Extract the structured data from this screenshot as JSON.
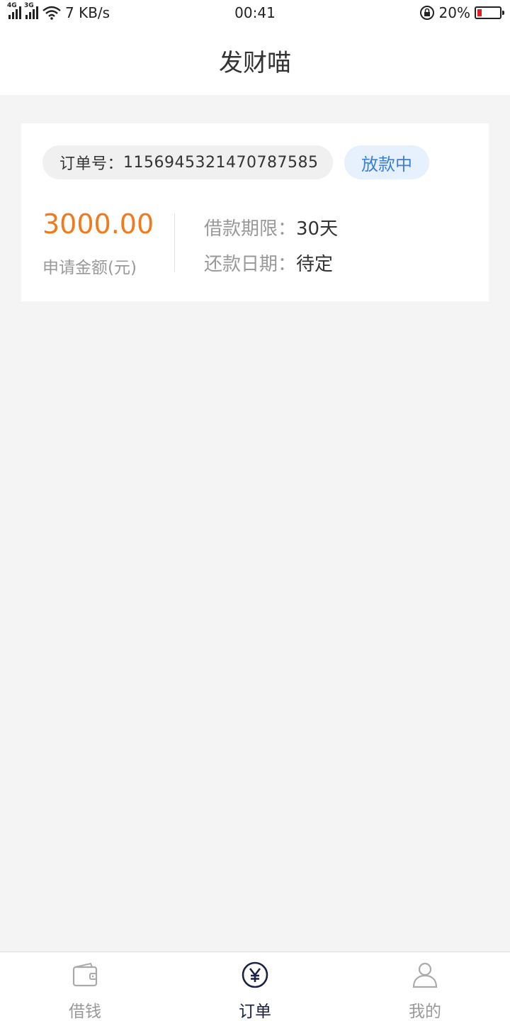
{
  "status_bar": {
    "network_1": "4G",
    "network_2": "3G",
    "speed": "7 KB/s",
    "time": "00:41",
    "battery": "20%",
    "battery_level": 0.2
  },
  "header": {
    "title": "发财喵"
  },
  "order": {
    "order_no_label": "订单号：",
    "order_no": "1156945321470787585",
    "status": "放款中",
    "amount": "3000.00",
    "amount_label": "申请金额(元)",
    "term_label": "借款期限：",
    "term_value": "30天",
    "repay_label": "还款日期：",
    "repay_value": "待定"
  },
  "tabs": [
    {
      "label": "借钱",
      "icon": "wallet-icon",
      "active": false
    },
    {
      "label": "订单",
      "icon": "yen-circle-icon",
      "active": true
    },
    {
      "label": "我的",
      "icon": "person-icon",
      "active": false
    }
  ],
  "colors": {
    "amount": "#f07a1c",
    "status_text": "#3a80d6",
    "status_bg": "#e7f1fd",
    "active_tab": "#1c2247"
  }
}
